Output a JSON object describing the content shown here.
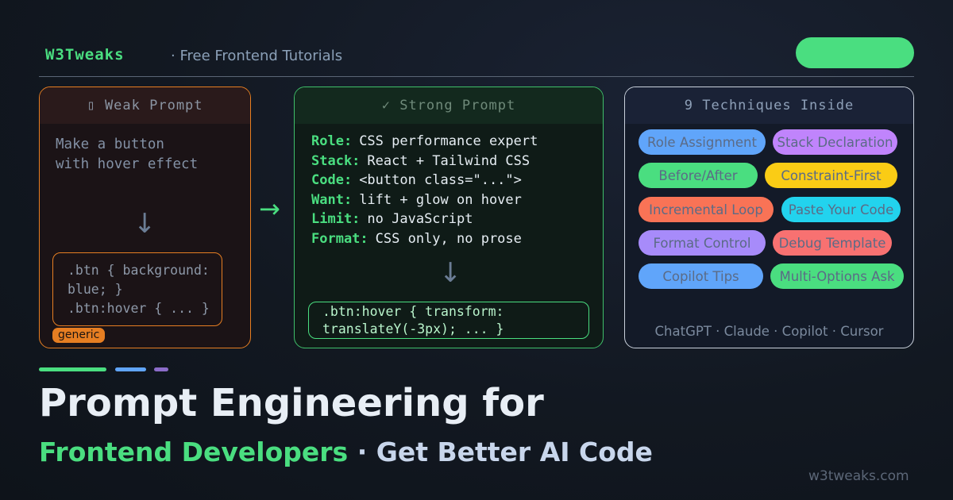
{
  "header": {
    "brand": "W3Tweaks",
    "tagline": "· Free Frontend Tutorials"
  },
  "colors": {
    "accent_green": "#4ade80",
    "accent_orange": "#e67e22",
    "accent_blue": "#60a5fa",
    "accent_purple": "#a78bfa"
  },
  "weak_card": {
    "title": "▯ Weak Prompt",
    "prompt_text": "Make a button\nwith hover effect",
    "arrow_icon": "arrow-down-icon",
    "code": ".btn { background:\nblue; }\n.btn:hover { ... }",
    "badge": "generic"
  },
  "strong_card": {
    "title": "✓ Strong Prompt",
    "rows": [
      {
        "key": "Role:",
        "value": "CSS performance expert"
      },
      {
        "key": "Stack:",
        "value": "React + Tailwind CSS"
      },
      {
        "key": "Code:",
        "value": "<button class=\"...\">"
      },
      {
        "key": "Want:",
        "value": "lift + glow on hover"
      },
      {
        "key": "Limit:",
        "value": "no JavaScript"
      },
      {
        "key": "Format:",
        "value": "CSS only, no prose"
      }
    ],
    "code": ".btn:hover { transform:\ntranslateY(-3px); ... }"
  },
  "transition_arrow": "→",
  "techniques_card": {
    "title": "9 Techniques Inside",
    "tags": [
      {
        "label": "Role Assignment",
        "color": "#60a5fa"
      },
      {
        "label": "Stack Declaration",
        "color": "#c084fc"
      },
      {
        "label": "Before/After",
        "color": "#4ade80"
      },
      {
        "label": "Constraint-First",
        "color": "#facc15"
      },
      {
        "label": "Incremental Loop",
        "color": "#f97356"
      },
      {
        "label": "Paste Your Code",
        "color": "#22d3ee"
      },
      {
        "label": "Format Control",
        "color": "#a78bfa"
      },
      {
        "label": "Debug Template",
        "color": "#f87171"
      },
      {
        "label": "Copilot Tips",
        "color": "#60a5fa"
      },
      {
        "label": "Multi-Options Ask",
        "color": "#4ade80"
      }
    ],
    "footer": "ChatGPT · Claude · Copilot · Cursor"
  },
  "title": {
    "line1": "Prompt Engineering for",
    "line2_green": "Frontend Developers",
    "line2_rest": "· Get Better AI Code"
  },
  "domain": "w3tweaks.com"
}
